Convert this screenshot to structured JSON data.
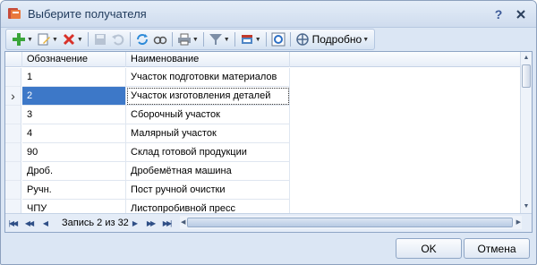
{
  "window": {
    "title": "Выберите получателя"
  },
  "toolbar": {
    "detail_label": "Подробно",
    "icons": [
      "add-icon",
      "edit-icon",
      "delete-icon",
      "save-icon",
      "undo-icon",
      "refresh-icon",
      "view-icon",
      "print-icon",
      "filter-icon",
      "export-icon",
      "settings-icon",
      "layout-icon"
    ]
  },
  "table": {
    "columns": [
      "Обозначение",
      "Наименование"
    ],
    "rows": [
      {
        "code": "1",
        "name": "Участок подготовки материалов"
      },
      {
        "code": "2",
        "name": "Участок изготовления деталей"
      },
      {
        "code": "3",
        "name": "Сборочный участок"
      },
      {
        "code": "4",
        "name": "Малярный участок"
      },
      {
        "code": "90",
        "name": "Склад готовой продукции"
      },
      {
        "code": "Дроб.",
        "name": "Дробемётная машина"
      },
      {
        "code": "Ручн.",
        "name": "Пост ручной очистки"
      },
      {
        "code": "ЧПУ",
        "name": "Листопробивной пресс"
      }
    ],
    "selected_row": 1
  },
  "navigator": {
    "record_text": "Запись 2 из 32"
  },
  "buttons": {
    "ok": "OK",
    "cancel": "Отмена"
  },
  "colors": {
    "selection": "#3d78c8",
    "window_bg": "#dbe6f4"
  }
}
